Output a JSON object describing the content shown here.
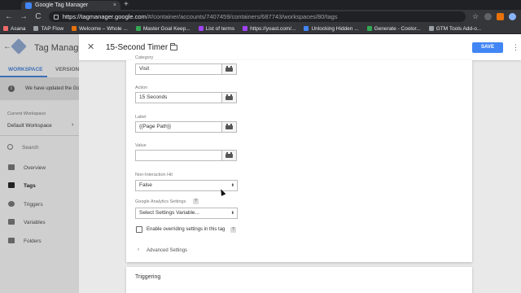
{
  "browser": {
    "tab_title": "Google Tag Manager",
    "tab_close": "×",
    "new_tab": "+",
    "url_host": "https://tagmanager.google.com",
    "url_path": "/#/container/accounts/7407459/containers/687743/workspaces/80/tags",
    "back": "←",
    "forward": "→",
    "reload": "C",
    "bookmarks": [
      {
        "label": "Asana",
        "color": "#f06a6a"
      },
      {
        "label": "TAP Flow",
        "color": "#9aa0a6"
      },
      {
        "label": "Welcome – Whole ...",
        "color": "#e8710a"
      },
      {
        "label": "Master Goal Keep...",
        "color": "#34a853"
      },
      {
        "label": "List of terms",
        "color": "#a142f4"
      },
      {
        "label": "https://yoast.com/...",
        "color": "#a142f4"
      },
      {
        "label": "Unlocking Hidden ...",
        "color": "#4285f4"
      },
      {
        "label": "Generate - Coolor...",
        "color": "#34a853"
      },
      {
        "label": "GTM Tools Add-o...",
        "color": "#9aa0a6"
      }
    ]
  },
  "gtm": {
    "back": "←",
    "title": "Tag Manage",
    "tab_workspace": "WORKSPACE",
    "tab_versions": "VERSIONS",
    "notice": "We have updated the Go",
    "notice_icon": "i",
    "current_workspace_label": "Current Workspace",
    "current_workspace": "Default Workspace",
    "chevron": "›",
    "search_placeholder": "Search",
    "nav": [
      {
        "label": "Overview",
        "active": false
      },
      {
        "label": "Tags",
        "active": true
      },
      {
        "label": "Triggers",
        "active": false
      },
      {
        "label": "Variables",
        "active": false
      },
      {
        "label": "Folders",
        "active": false
      }
    ]
  },
  "panel": {
    "close": "✕",
    "tag_name": "15-Second Timer",
    "save_label": "SAVE",
    "more": "⋮",
    "fields": {
      "category_label": "Category",
      "category_value": "Visit",
      "action_label": "Action",
      "action_value": "15 Seconds",
      "label_label": "Label",
      "label_value": "{{Page Path}}",
      "value_label": "Value",
      "value_value": ""
    },
    "non_interaction_label": "Non-Interaction Hit",
    "non_interaction_value": "False",
    "ga_settings_label": "Google Analytics Settings",
    "ga_settings_value": "Select Settings Variable...",
    "help": "?",
    "override_label": "Enable overriding settings in this tag",
    "override_checked": false,
    "advanced_chevron": "›",
    "advanced_label": "Advanced Settings",
    "triggering_label": "Triggering"
  }
}
